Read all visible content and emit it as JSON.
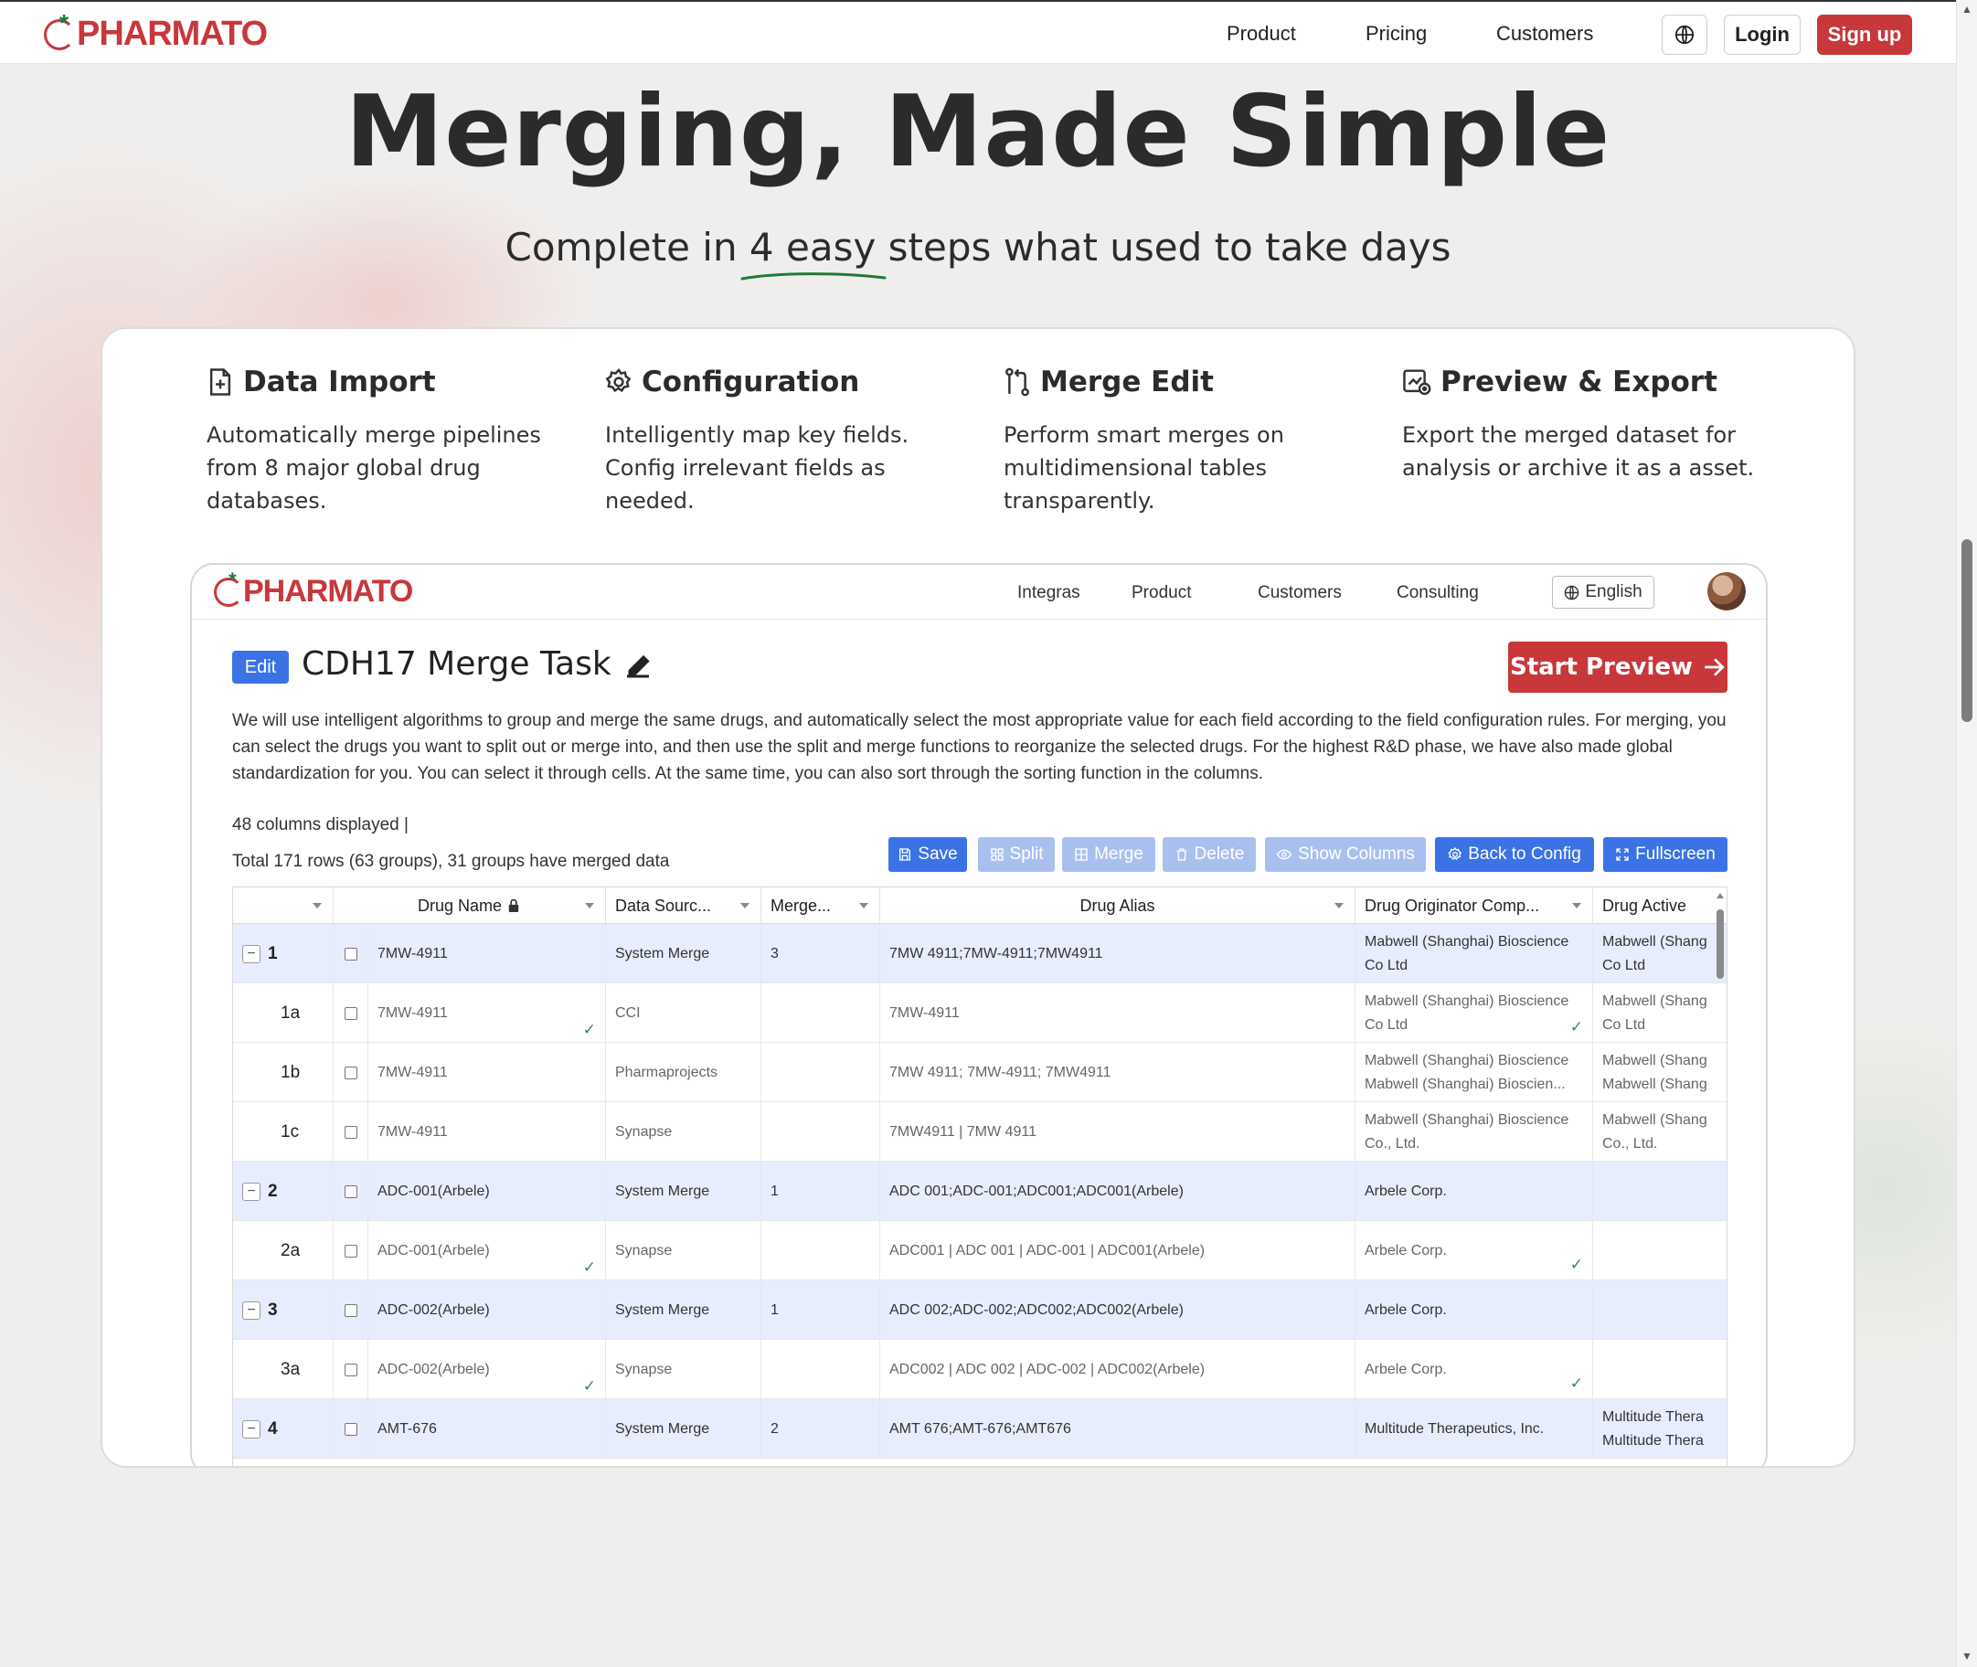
{
  "nav": {
    "brand": "PHARMATO",
    "links": [
      "Product",
      "Pricing",
      "Customers"
    ],
    "login": "Login",
    "signup": "Sign up"
  },
  "hero": {
    "title": "Merging, Made Simple",
    "subtitle": "Complete in 4 easy steps what used to take days"
  },
  "steps": [
    {
      "icon": "file-plus-icon",
      "title": "Data Import",
      "desc": "Automatically merge pipelines from 8 major global drug databases."
    },
    {
      "icon": "gear-icon",
      "title": "Configuration",
      "desc": "Intelligently map key fields. Config irrelevant fields as needed."
    },
    {
      "icon": "merge-icon",
      "title": "Merge Edit",
      "desc": "Perform smart merges on multidimensional tables transparently."
    },
    {
      "icon": "chart-export-icon",
      "title": "Preview & Export",
      "desc": "Export the merged dataset for analysis or archive it as a asset."
    }
  ],
  "app": {
    "brand": "PHARMATO",
    "links": [
      "Integras",
      "Product",
      "Customers",
      "Consulting"
    ],
    "language": "English",
    "badge": "Edit",
    "task_title": "CDH17 Merge Task",
    "start_preview": "Start Preview",
    "description": "We will use intelligent algorithms to group and merge the same drugs, and automatically select the most appropriate value for each field according to the field configuration rules. For merging, you can select the drugs you want to split out or merge into, and then use the split and merge functions to reorganize the selected drugs. For the highest R&D phase, we have also made global standardization for you. You can select it through cells. At the same time, you can also sort through the sorting function in the columns.",
    "columns_info": "48 columns displayed  |",
    "rows_info": "Total 171 rows (63 groups), 31 groups have merged data",
    "toolbar": {
      "save": "Save",
      "split": "Split",
      "merge": "Merge",
      "delete": "Delete",
      "show_columns": "Show Columns",
      "back_to_config": "Back to Config",
      "fullscreen": "Fullscreen"
    },
    "table": {
      "headers": {
        "drug_name": "Drug Name",
        "data_source": "Data Sourc...",
        "merged": "Merge...",
        "drug_alias": "Drug Alias",
        "originator": "Drug Originator Comp...",
        "active": "Drug Active"
      },
      "rows": [
        {
          "type": "parent",
          "idx": "1",
          "name": "7MW-4911",
          "source": "System Merge",
          "merged": "3",
          "alias": "7MW 4911;7MW-4911;7MW4911",
          "originator": "Mabwell (Shanghai) Bioscience Co Ltd",
          "active": "Mabwell (Shang Co Ltd"
        },
        {
          "type": "child",
          "idx": "1a",
          "name": "7MW-4911",
          "source": "CCI",
          "merged": "",
          "alias": "7MW-4911",
          "originator": "Mabwell (Shanghai) Bioscience Co Ltd",
          "active": "Mabwell (Shang Co Ltd"
        },
        {
          "type": "child",
          "idx": "1b",
          "name": "7MW-4911",
          "source": "Pharmaprojects",
          "merged": "",
          "alias": "7MW 4911; 7MW-4911; 7MW4911",
          "originator": "Mabwell (Shanghai) Bioscience Mabwell (Shanghai) Bioscien...",
          "active": "Mabwell (Shang Mabwell (Shang"
        },
        {
          "type": "child",
          "idx": "1c",
          "name": "7MW-4911",
          "source": "Synapse",
          "merged": "",
          "alias": "7MW4911 | 7MW 4911",
          "originator": "Mabwell (Shanghai) Bioscience Co., Ltd.",
          "active": "Mabwell (Shang Co., Ltd."
        },
        {
          "type": "parent",
          "idx": "2",
          "name": "ADC-001(Arbele)",
          "source": "System Merge",
          "merged": "1",
          "alias": "ADC 001;ADC-001;ADC001;ADC001(Arbele)",
          "originator": "Arbele Corp.",
          "active": ""
        },
        {
          "type": "child",
          "idx": "2a",
          "name": "ADC-001(Arbele)",
          "source": "Synapse",
          "merged": "",
          "alias": "ADC001 | ADC 001 | ADC-001 | ADC001(Arbele)",
          "originator": "Arbele Corp.",
          "active": ""
        },
        {
          "type": "parent",
          "idx": "3",
          "name": "ADC-002(Arbele)",
          "source": "System Merge",
          "merged": "1",
          "alias": "ADC 002;ADC-002;ADC002;ADC002(Arbele)",
          "originator": "Arbele Corp.",
          "active": ""
        },
        {
          "type": "child",
          "idx": "3a",
          "name": "ADC-002(Arbele)",
          "source": "Synapse",
          "merged": "",
          "alias": "ADC002 | ADC 002 | ADC-002 | ADC002(Arbele)",
          "originator": "Arbele Corp.",
          "active": ""
        },
        {
          "type": "parent",
          "idx": "4",
          "name": "AMT-676",
          "source": "System Merge",
          "merged": "2",
          "alias": "AMT 676;AMT-676;AMT676",
          "originator": "Multitude Therapeutics, Inc.",
          "active": "Multitude Thera Multitude Thera"
        }
      ]
    }
  },
  "colors": {
    "brand_red": "#c8373a",
    "accent_blue": "#3b73e6",
    "row_highlight": "#e8edfd",
    "check_green": "#2e8b57"
  }
}
